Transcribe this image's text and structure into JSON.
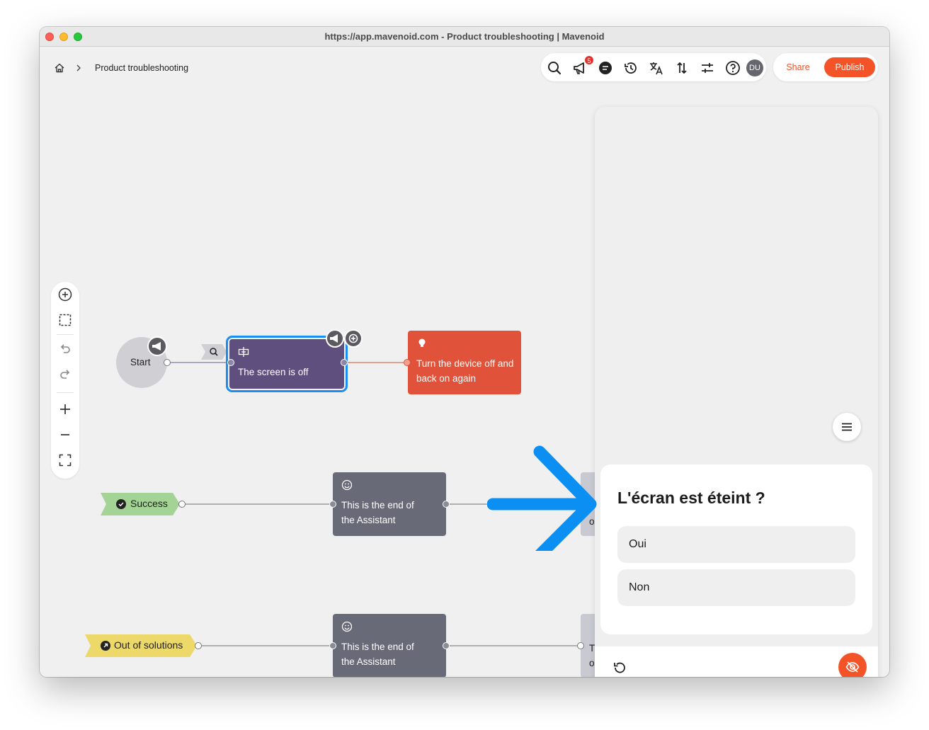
{
  "window": {
    "title": "https://app.mavenoid.com - Product troubleshooting | Mavenoid"
  },
  "breadcrumb": {
    "current": "Product troubleshooting"
  },
  "toolbar": {
    "notification_count": "5",
    "avatar_initials": "DU",
    "share_label": "Share",
    "publish_label": "Publish",
    "accent_color": "#f45327"
  },
  "flow": {
    "start_label": "Start",
    "question_node": "The screen is off",
    "solution_node": "Turn the device off and back on again",
    "success_tag": "Success",
    "out_of_solutions_tag": "Out of solutions",
    "end_node_1": "This is the end of the Assistant",
    "end_node_2": "This is the end of the Assistant",
    "cut_node_1_line1": "T",
    "cut_node_1_line2": "o",
    "cut_node_2_line1": "T",
    "cut_node_2_line2": "ou"
  },
  "preview": {
    "question": "L'écran est éteint ?",
    "answers": [
      "Oui",
      "Non"
    ]
  }
}
